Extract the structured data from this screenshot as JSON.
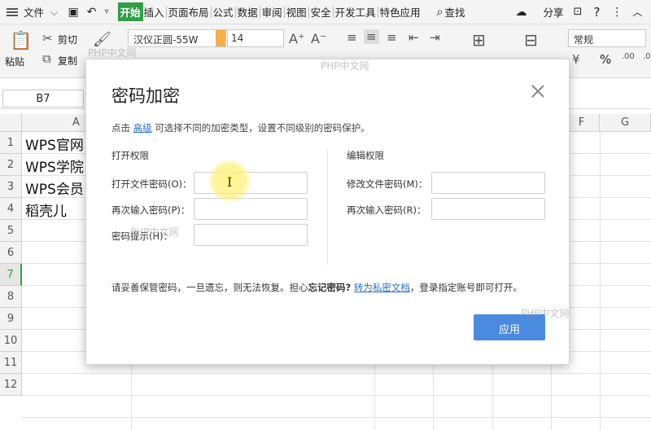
{
  "menubar": {
    "file": "文件",
    "tabs": [
      "开始",
      "插入",
      "页面布局",
      "公式",
      "数据",
      "审阅",
      "视图",
      "安全",
      "开发工具",
      "特色应用"
    ],
    "active_tab": "开始",
    "search": "查找",
    "share": "分享"
  },
  "ribbon": {
    "paste": "粘贴",
    "cut": "剪切",
    "copy": "复制",
    "font_name": "汉仪正圆-55W",
    "font_size": "14",
    "number_format": "常规"
  },
  "formula_bar": {
    "name_box": "B7"
  },
  "sheet": {
    "columns": [
      "A",
      "F",
      "G"
    ],
    "rows": [
      "1",
      "2",
      "3",
      "4",
      "5",
      "6",
      "7",
      "8",
      "9",
      "10",
      "11",
      "12"
    ],
    "selected_row": "7",
    "cells": [
      "WPS官网",
      "WPS学院",
      "WPS会员",
      "稻壳儿"
    ]
  },
  "dialog": {
    "title": "密码加密",
    "desc_prefix": "点击",
    "desc_link": "高级",
    "desc_suffix": "可选择不同的加密类型，设置不同级别的密码保护。",
    "open_section": "打开权限",
    "edit_section": "编辑权限",
    "open_password_label": "打开文件密码(O)：",
    "open_confirm_label": "再次输入密码(P)：",
    "hint_label": "密码提示(H)：",
    "modify_password_label": "修改文件密码(M)：",
    "modify_confirm_label": "再次输入密码(R)：",
    "warning_text": "请妥善保管密码，一旦遗忘，则无法恢复。担心",
    "warning_bold": "忘记密码?",
    "warning_link": "转为私密文档",
    "warning_tail": "，登录指定账号即可打开。",
    "apply_button": "应用"
  },
  "watermark": "PHP中文网"
}
